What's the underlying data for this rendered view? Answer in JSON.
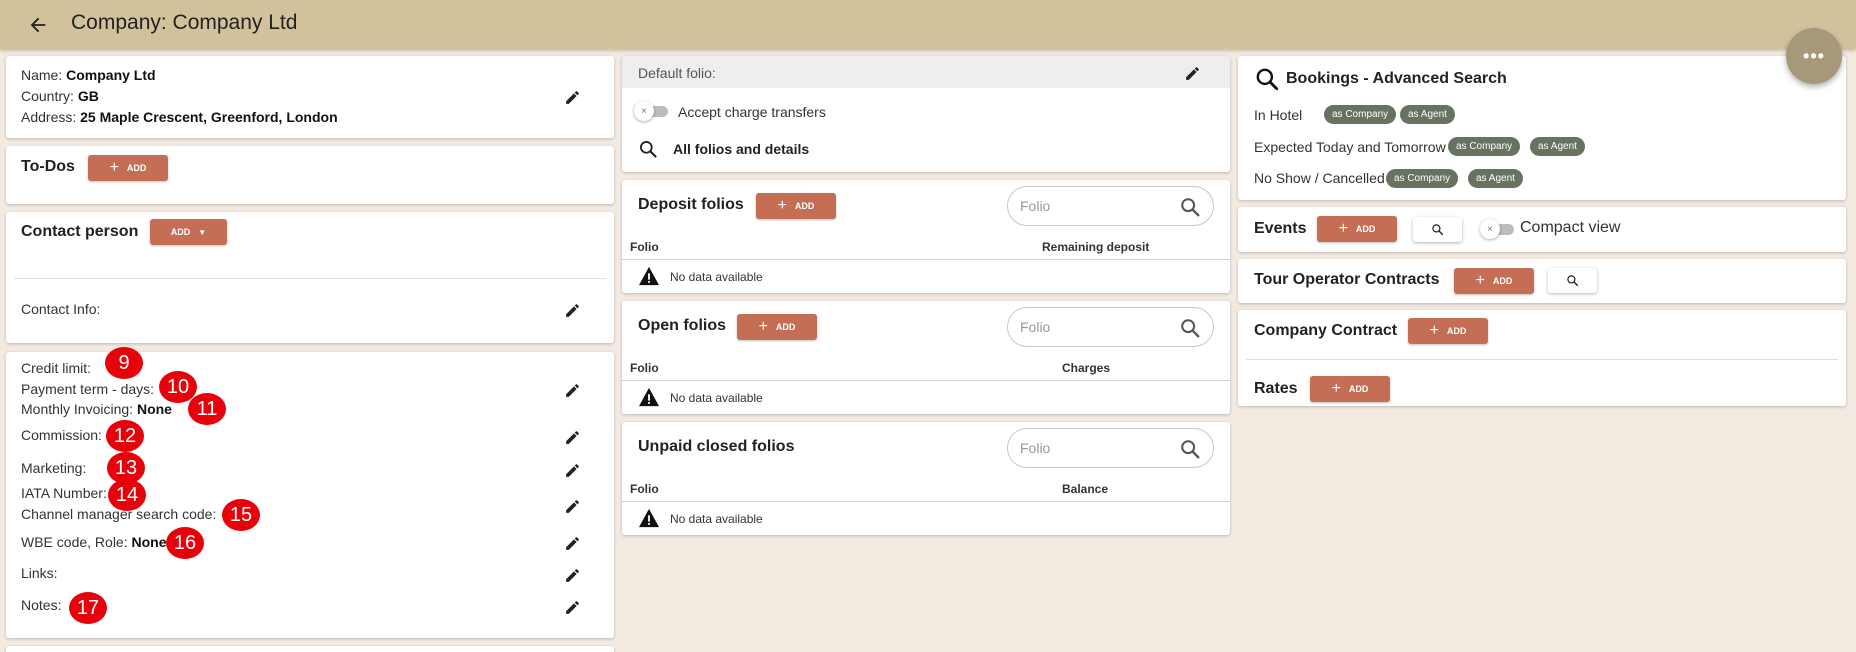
{
  "header": {
    "title": "Company: Company Ltd",
    "fab_label": "•••"
  },
  "company": {
    "name_label": "Name:",
    "name_value": "Company Ltd",
    "country_label": "Country:",
    "country_value": "GB",
    "address_label": "Address:",
    "address_value": "25 Maple Crescent, Greenford, London"
  },
  "todos": {
    "title": "To-Dos",
    "add_label": "ADD"
  },
  "contact": {
    "title": "Contact person",
    "add_label": "ADD",
    "info_label": "Contact Info:"
  },
  "details": {
    "credit_limit": "Credit limit:",
    "payment_term": "Payment term - days:",
    "monthly_invoicing_label": "Monthly Invoicing:",
    "monthly_invoicing_value": "None",
    "commission": "Commission:",
    "marketing": "Marketing:",
    "iata": "IATA Number:",
    "channel_manager": "Channel manager search code:",
    "wbe_label": "WBE code, Role:",
    "wbe_value": "None",
    "links": "Links:",
    "notes": "Notes:"
  },
  "markers": [
    "9",
    "10",
    "11",
    "12",
    "13",
    "14",
    "15",
    "16",
    "17"
  ],
  "folio_settings": {
    "default_folio": "Default folio:",
    "accept_transfers": "Accept charge transfers",
    "all_folios": "All folios and details"
  },
  "deposit_folios": {
    "title": "Deposit folios",
    "add_label": "ADD",
    "search_placeholder": "Folio",
    "col_folio": "Folio",
    "col_other": "Remaining deposit",
    "no_data": "No data available"
  },
  "open_folios": {
    "title": "Open folios",
    "add_label": "ADD",
    "search_placeholder": "Folio",
    "col_folio": "Folio",
    "col_other": "Charges",
    "no_data": "No data available"
  },
  "unpaid_folios": {
    "title": "Unpaid closed folios",
    "search_placeholder": "Folio",
    "col_folio": "Folio",
    "col_other": "Balance",
    "no_data": "No data available"
  },
  "bookings": {
    "title": "Bookings - Advanced Search",
    "in_hotel": "In Hotel",
    "expected": "Expected Today and Tomorrow",
    "noshow": "No Show / Cancelled",
    "as_company": "as Company",
    "as_agent": "as Agent"
  },
  "events": {
    "title": "Events",
    "add_label": "ADD",
    "compact_view": "Compact view"
  },
  "tour_operator": {
    "title": "Tour Operator Contracts",
    "add_label": "ADD"
  },
  "company_contract": {
    "title": "Company Contract",
    "add_label": "ADD"
  },
  "rates": {
    "title": "Rates",
    "add_label": "ADD"
  },
  "colors": {
    "header": "#d1c29c",
    "accent": "#c46e56",
    "badge": "#667360",
    "marker": "#e8000b",
    "background": "#f3eae2"
  }
}
